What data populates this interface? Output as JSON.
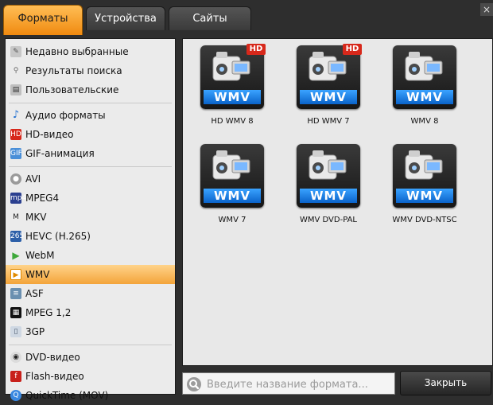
{
  "tabs": [
    {
      "label": "Форматы",
      "active": true
    },
    {
      "label": "Устройства",
      "active": false
    },
    {
      "label": "Сайты",
      "active": false
    }
  ],
  "sidebar": {
    "groups": [
      [
        {
          "label": "Недавно выбранные",
          "icon": "recent-icon"
        },
        {
          "label": "Результаты поиска",
          "icon": "search-results-icon"
        },
        {
          "label": "Пользовательские",
          "icon": "user-presets-icon"
        }
      ],
      [
        {
          "label": "Аудио форматы",
          "icon": "audio-note-icon"
        },
        {
          "label": "HD-видео",
          "icon": "hd-icon"
        },
        {
          "label": "GIF-анимация",
          "icon": "gif-icon"
        }
      ],
      [
        {
          "label": "AVI",
          "icon": "avi-icon"
        },
        {
          "label": "MPEG4",
          "icon": "mp4-icon"
        },
        {
          "label": "MKV",
          "icon": "mkv-icon"
        },
        {
          "label": "HEVC (H.265)",
          "icon": "hevc-icon"
        },
        {
          "label": "WebM",
          "icon": "webm-play-icon"
        },
        {
          "label": "WMV",
          "icon": "wmv-icon",
          "active": true
        },
        {
          "label": "ASF",
          "icon": "asf-icon"
        },
        {
          "label": "MPEG 1,2",
          "icon": "mpeg-icon"
        },
        {
          "label": "3GP",
          "icon": "phone-icon"
        }
      ],
      [
        {
          "label": "DVD-видео",
          "icon": "dvd-icon"
        },
        {
          "label": "Flash-видео",
          "icon": "flash-icon"
        },
        {
          "label": "QuickTime (MOV)",
          "icon": "quicktime-icon"
        }
      ]
    ]
  },
  "formats": [
    {
      "label": "HD WMV 8",
      "badge_text": "WMV",
      "hd": "HD"
    },
    {
      "label": "HD WMV 7",
      "badge_text": "WMV",
      "hd": "HD"
    },
    {
      "label": "WMV 8",
      "badge_text": "WMV",
      "hd": ""
    },
    {
      "label": "WMV 7",
      "badge_text": "WMV",
      "hd": ""
    },
    {
      "label": "WMV DVD-PAL",
      "badge_text": "WMV",
      "hd": ""
    },
    {
      "label": "WMV DVD-NTSC",
      "badge_text": "WMV",
      "hd": ""
    }
  ],
  "search": {
    "placeholder": "Введите название формата..."
  },
  "close_button": {
    "label": "Закрыть"
  },
  "window_close_glyph": "×",
  "colors": {
    "accent": "#f3a43a",
    "wmv_blue": "#1a78e0",
    "hd_red": "#d7281b"
  }
}
